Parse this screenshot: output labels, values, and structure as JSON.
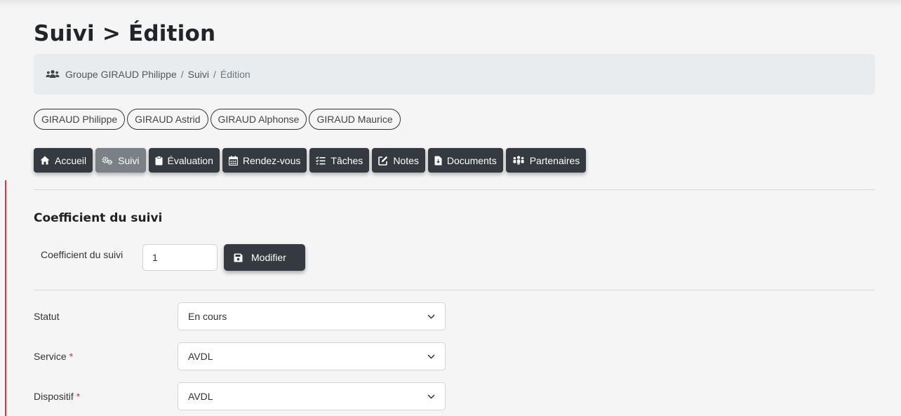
{
  "page": {
    "title": "Suivi > Édition"
  },
  "breadcrumb": {
    "icon": "users-icon",
    "items": [
      "Groupe GIRAUD Philippe",
      "Suivi",
      "Édition"
    ],
    "separator": "/"
  },
  "persons": [
    "GIRAUD Philippe",
    "GIRAUD Astrid",
    "GIRAUD Alphonse",
    "GIRAUD Maurice"
  ],
  "tabs": [
    {
      "label": "Accueil",
      "icon": "home-icon",
      "active": false
    },
    {
      "label": "Suivi",
      "icon": "gears-icon",
      "active": true
    },
    {
      "label": "Évaluation",
      "icon": "clipboard-icon",
      "active": false
    },
    {
      "label": "Rendez-vous",
      "icon": "calendar-icon",
      "active": false
    },
    {
      "label": "Tâches",
      "icon": "tasks-icon",
      "active": false
    },
    {
      "label": "Notes",
      "icon": "edit-icon",
      "active": false
    },
    {
      "label": "Documents",
      "icon": "file-icon",
      "active": false
    },
    {
      "label": "Partenaires",
      "icon": "people-group-icon",
      "active": false
    }
  ],
  "coefficient": {
    "section_title": "Coefficient du suivi",
    "label": "Coefficient du suivi",
    "value": "1",
    "button_label": "Modifier",
    "button_icon": "save-icon"
  },
  "form": {
    "required_marker": "*",
    "statut": {
      "label": "Statut",
      "value": "En cours",
      "required": false
    },
    "service": {
      "label": "Service",
      "value": "AVDL",
      "required": true
    },
    "dispositif": {
      "label": "Dispositif",
      "value": "AVDL",
      "required": true
    }
  },
  "colors": {
    "tab_bg": "#343a40",
    "tab_active_bg": "#7b8086",
    "required": "#dc3545",
    "breadcrumb_bg": "#e9ecef"
  }
}
